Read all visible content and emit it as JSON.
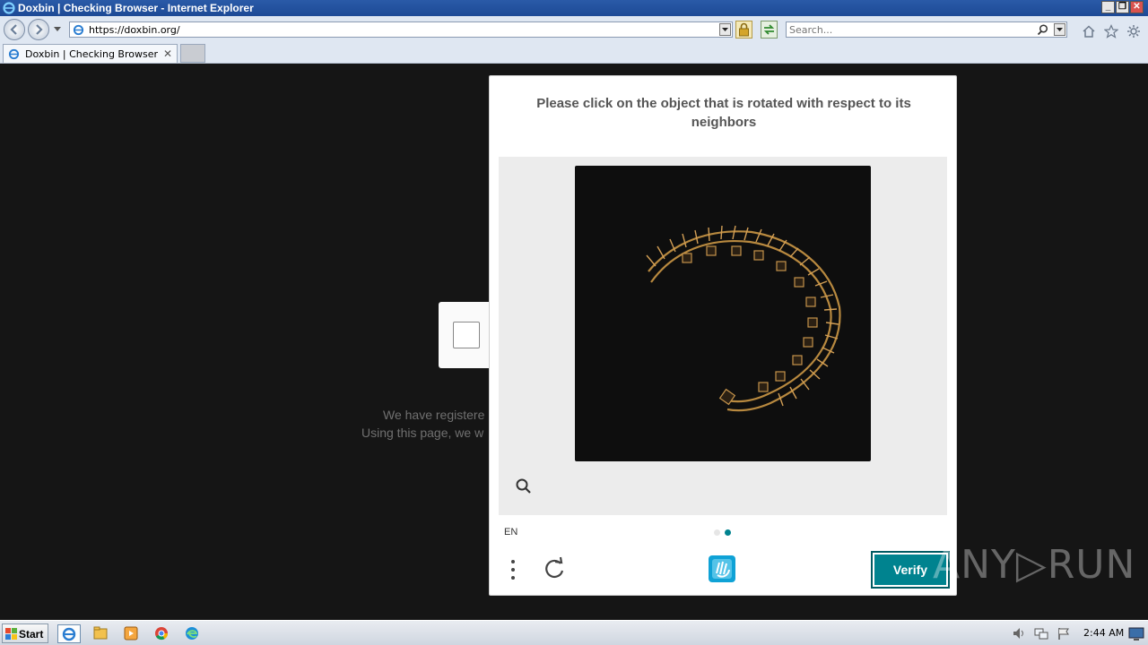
{
  "window": {
    "title": "Doxbin | Checking Browser - Internet Explorer",
    "controls": [
      "_",
      "❐",
      "✕"
    ]
  },
  "address_bar": {
    "url": "https://doxbin.org/",
    "search_placeholder": "Search..."
  },
  "tabs": [
    {
      "label": "Doxbin | Checking Browser",
      "close": "✕"
    }
  ],
  "page": {
    "background_lines": [
      "We have registere",
      "Using this page, we w"
    ]
  },
  "captcha": {
    "prompt": "Please click on the object that is rotated with respect to its neighbors",
    "language": "EN",
    "verify_label": "Verify",
    "page_indicator": {
      "total": 2,
      "current": 2
    },
    "accent_color": "#00838f"
  },
  "watermark": "ANY▷RUN",
  "taskbar": {
    "start_label": "Start",
    "apps": [
      "internet-explorer-icon",
      "file-explorer-icon",
      "media-player-icon",
      "chrome-icon",
      "edge-icon"
    ],
    "clock": "2:44 AM"
  }
}
